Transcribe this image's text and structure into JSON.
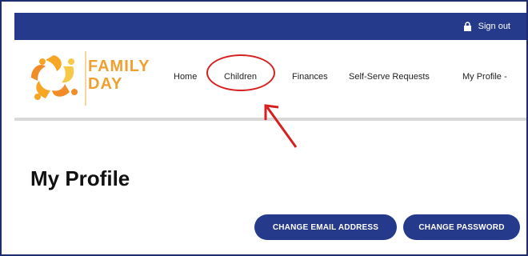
{
  "topbar": {
    "signout_label": "Sign out"
  },
  "brand": {
    "line1": "FAMILY",
    "line2": "DAY"
  },
  "nav": {
    "items": [
      {
        "label": "Home"
      },
      {
        "label": "Children"
      },
      {
        "label": "Finances"
      },
      {
        "label": "Self-Serve Requests"
      },
      {
        "label": "My Profile -"
      }
    ]
  },
  "page": {
    "title": "My Profile"
  },
  "actions": {
    "change_email_label": "CHANGE EMAIL ADDRESS",
    "change_password_label": "CHANGE PASSWORD"
  },
  "colors": {
    "primary": "#263a8c",
    "brand_orange": "#f0a030",
    "annotation_red": "#d62020"
  },
  "icons": {
    "lock": "lock-icon",
    "logo": "family-day-logo"
  }
}
